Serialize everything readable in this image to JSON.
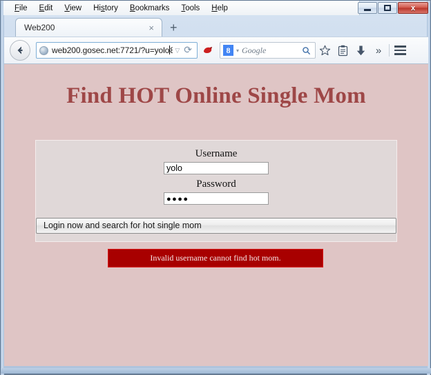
{
  "window": {
    "caption_buttons": {
      "minimize": "minimize-button",
      "maximize": "restore-button",
      "close_label": "x"
    }
  },
  "menubar": {
    "items": [
      {
        "label": "File",
        "accel": "F"
      },
      {
        "label": "Edit",
        "accel": "E"
      },
      {
        "label": "View",
        "accel": "V"
      },
      {
        "label": "History",
        "accel": "s"
      },
      {
        "label": "Bookmarks",
        "accel": "B"
      },
      {
        "label": "Tools",
        "accel": "T"
      },
      {
        "label": "Help",
        "accel": "H"
      }
    ]
  },
  "tabs": {
    "active_tab_label": "Web200",
    "close_glyph": "×",
    "new_tab_glyph": "+"
  },
  "toolbar": {
    "back_glyph": "←",
    "url_before_caret": "web200.gosec.net:7721/?u=yolo",
    "url_after_caret": "8",
    "url_full": "web200.gosec.net:7721/?u=yolo8",
    "url_dropdown_glyph": "▽",
    "reload_glyph": "⟳",
    "search_engine_logo": "8",
    "search_engine_dropdown_glyph": "▾",
    "search_placeholder": "Google",
    "search_mag_glyph": "⚲",
    "bookmark_glyph": "☆",
    "reading_list_glyph": "Ὄb",
    "download_glyph": "⬇",
    "overflow_glyph": "»"
  },
  "page": {
    "title": "Find HOT Online Single Mom",
    "form": {
      "username_label": "Username",
      "username_value": "yolo",
      "password_label": "Password",
      "password_value": "●●●●",
      "submit_label": "Login now and search for hot single mom"
    },
    "error_message": "Invalid username cannot find hot mom."
  },
  "colors": {
    "page_background": "#dfc5c5",
    "panel_background": "#e0d8d8",
    "title_color": "#9e4747",
    "error_background": "#a80000",
    "error_border": "#d81818",
    "error_text": "#f7e6e6"
  }
}
